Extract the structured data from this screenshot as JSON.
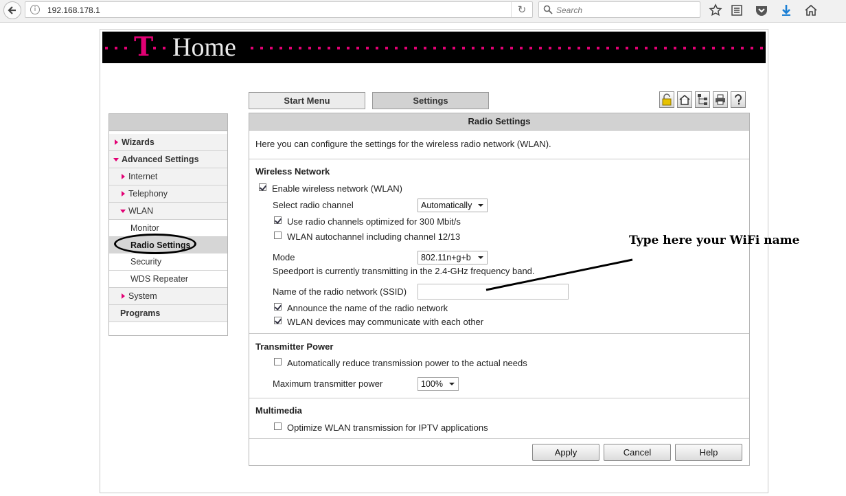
{
  "browser": {
    "url": "192.168.178.1",
    "search_placeholder": "Search"
  },
  "banner": {
    "brand_letter": "T",
    "brand_name": "Home"
  },
  "tabs": [
    {
      "label": "Start Menu"
    },
    {
      "label": "Settings"
    }
  ],
  "sidebar": {
    "items": [
      {
        "label": "Wizards"
      },
      {
        "label": "Advanced Settings"
      },
      {
        "label": "Internet"
      },
      {
        "label": "Telephony"
      },
      {
        "label": "WLAN"
      },
      {
        "label": "Monitor"
      },
      {
        "label": "Radio Settings"
      },
      {
        "label": "Security"
      },
      {
        "label": "WDS Repeater"
      },
      {
        "label": "System"
      },
      {
        "label": "Programs"
      }
    ]
  },
  "panel": {
    "title": "Radio Settings",
    "intro": "Here you can configure the settings for the wireless radio network (WLAN).",
    "wireless": {
      "heading": "Wireless Network",
      "enable_label": "Enable wireless network (WLAN)",
      "enable_checked": true,
      "channel_label": "Select radio channel",
      "channel_value": "Automatically",
      "opt300_label": "Use radio channels optimized for 300 Mbit/s",
      "opt300_checked": true,
      "autochannel_label": "WLAN autochannel including channel 12/13",
      "autochannel_checked": false,
      "mode_label": "Mode",
      "mode_value": "802.11n+g+b",
      "band_text": "Speedport is currently transmitting in the 2.4-GHz frequency band.",
      "ssid_label": "Name of the radio network (SSID)",
      "ssid_value": "",
      "announce_label": "Announce the name of the radio network",
      "announce_checked": true,
      "communicate_label": "WLAN devices may communicate with each other",
      "communicate_checked": true
    },
    "transmitter": {
      "heading": "Transmitter Power",
      "reduce_label": "Automatically reduce transmission power to the actual needs",
      "reduce_checked": false,
      "max_label": "Maximum transmitter power",
      "max_value": "100%"
    },
    "multimedia": {
      "heading": "Multimedia",
      "iptv_label": "Optimize WLAN transmission for IPTV applications",
      "iptv_checked": false
    },
    "buttons": {
      "apply": "Apply",
      "cancel": "Cancel",
      "help": "Help"
    }
  },
  "annotation": {
    "text": "Type here your WiFi name"
  },
  "colors": {
    "brand_magenta": "#e20074",
    "banner_bg": "#000000"
  }
}
